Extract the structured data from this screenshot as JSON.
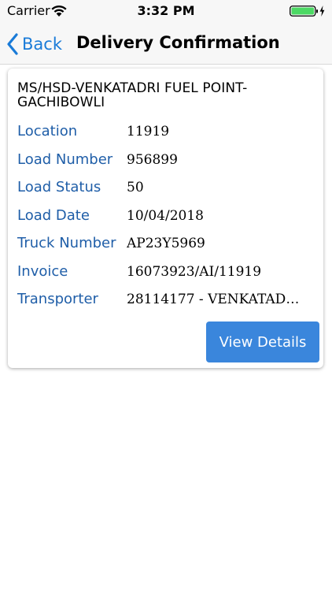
{
  "status_bar": {
    "carrier": "Carrier",
    "time": "3:32 PM"
  },
  "nav": {
    "back_label": "Back",
    "title": "Delivery Confirmation"
  },
  "card": {
    "title": "MS/HSD-VENKATADRI FUEL POINT-GACHIBOWLI",
    "rows": [
      {
        "label": "Location",
        "value": "11919"
      },
      {
        "label": "Load Number",
        "value": "956899"
      },
      {
        "label": "Load Status",
        "value": "50"
      },
      {
        "label": "Load Date",
        "value": "10/04/2018"
      },
      {
        "label": "Truck Number",
        "value": "AP23Y5969"
      },
      {
        "label": "Invoice",
        "value": "16073923/AI/11919"
      },
      {
        "label": "Transporter",
        "value": "28114177 - VENKATAD…"
      }
    ],
    "button_label": "View Details"
  },
  "colors": {
    "accent": "#1a7bd8",
    "label": "#1f5ea8",
    "button": "#3a86dc",
    "battery": "#4cd964"
  },
  "icons": [
    "wifi-icon",
    "battery-icon",
    "charging-bolt-icon",
    "chevron-left-icon"
  ]
}
